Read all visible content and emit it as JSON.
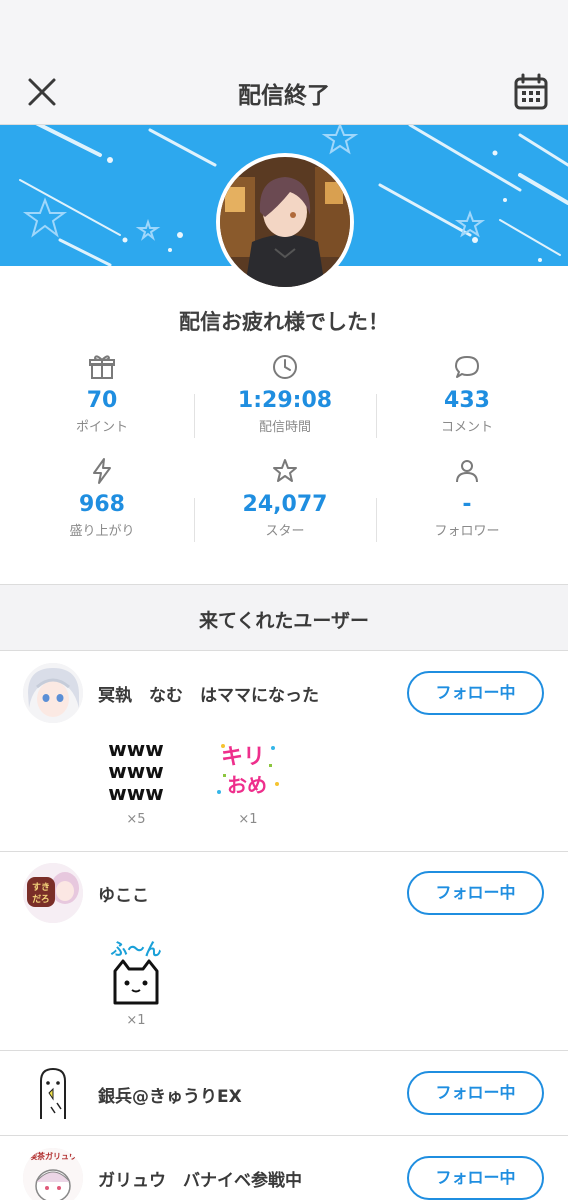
{
  "header": {
    "title": "配信終了",
    "close_icon": "close-icon",
    "calendar_icon": "calendar-icon"
  },
  "greeting": "配信お疲れ様でした！",
  "stats": [
    {
      "icon": "gift-icon",
      "value": "70",
      "label": "ポイント"
    },
    {
      "icon": "clock-icon",
      "value": "1:29:08",
      "label": "配信時間"
    },
    {
      "icon": "comment-icon",
      "value": "433",
      "label": "コメント"
    },
    {
      "icon": "lightning-icon",
      "value": "968",
      "label": "盛り上がり"
    },
    {
      "icon": "star-icon",
      "value": "24,077",
      "label": "スター"
    },
    {
      "icon": "person-icon",
      "value": "-",
      "label": "フォロワー"
    }
  ],
  "section_title": "来てくれたユーザー",
  "users": [
    {
      "name": "冥執　なむ　はママになった",
      "follow_label": "フォロー中",
      "stamps": [
        {
          "text": "www\nwww\nwww",
          "count": "×5"
        },
        {
          "text": "キリおめ",
          "count": "×1"
        }
      ]
    },
    {
      "name": "ゆここ",
      "follow_label": "フォロー中",
      "stamps": [
        {
          "text": "ふ〜ん",
          "count": "×1"
        }
      ]
    },
    {
      "name": "銀兵@きゅうりEX",
      "follow_label": "フォロー中",
      "stamps": []
    },
    {
      "name": "ガリュウ　バナイベ参戦中",
      "follow_label": "フォロー中",
      "stamps": []
    }
  ],
  "colors": {
    "accent": "#1f8ee0",
    "banner": "#2da8ee"
  }
}
